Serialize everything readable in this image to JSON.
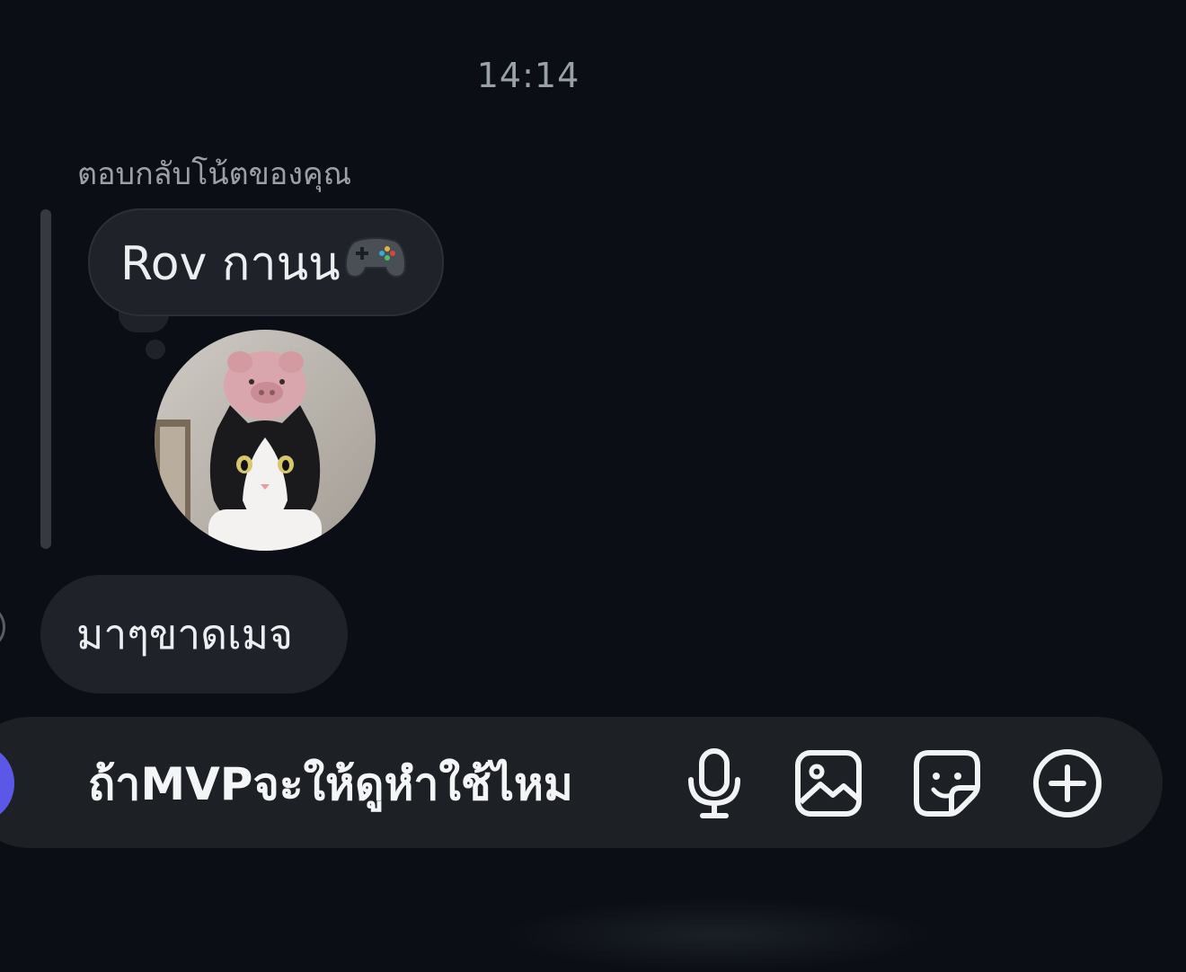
{
  "chat": {
    "timestamp": "14:14",
    "reply_caption": "ตอบกลับโน้ตของคุณ",
    "note": {
      "text": "Rov กานน",
      "emoji": "gamepad-icon"
    },
    "message": "มาๆขาดเมจ"
  },
  "composer": {
    "text": "ถ้าMVPจะให้ดูหำใช้ไหม",
    "icons": [
      "microphone-icon",
      "image-icon",
      "sticker-icon",
      "plus-circle-icon"
    ]
  },
  "colors": {
    "background": "#0b0f15",
    "bubble": "#1f2329",
    "composer": "#1d2025",
    "accent": "#5b58e8"
  }
}
